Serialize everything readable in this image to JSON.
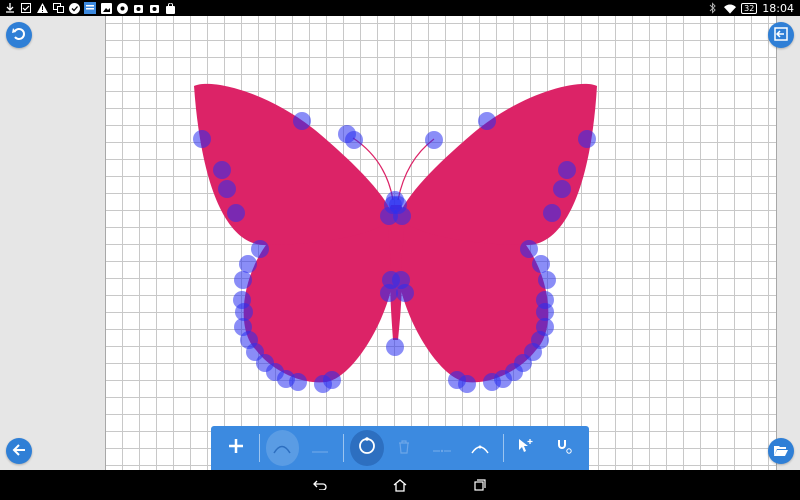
{
  "status_bar": {
    "time": "18:04",
    "battery": "32",
    "left_icons": [
      "download-icon",
      "checkbox-icon",
      "warning-icon",
      "screen-mirror-icon",
      "check-circle-icon",
      "app-icon",
      "image-icon",
      "chrome-icon",
      "photo-icon",
      "photo-icon",
      "bag-icon"
    ],
    "right_icons": [
      "bluetooth-icon",
      "wifi-icon",
      "battery-icon"
    ]
  },
  "colors": {
    "accent": "#3c8ae0",
    "butterfly_fill": "#dc2367",
    "control_point": "#2a2ff0"
  },
  "toolbar": {
    "items": [
      "add-icon",
      "curve-icon",
      "line-icon",
      "select-circle-icon",
      "delete-icon",
      "split-icon",
      "smooth-icon",
      "pointer-add-icon",
      "magnet-icon"
    ],
    "active": "select-circle-icon",
    "disabled": [
      "curve-icon",
      "line-icon",
      "delete-icon",
      "split-icon",
      "smooth-icon"
    ]
  },
  "side_buttons": {
    "top_left": "undo-icon",
    "top_right": "exit-icon",
    "bottom_left": "back-arrow-icon",
    "bottom_right": "folder-open-icon"
  },
  "navigation": [
    "back-icon",
    "home-icon",
    "recent-apps-icon"
  ]
}
